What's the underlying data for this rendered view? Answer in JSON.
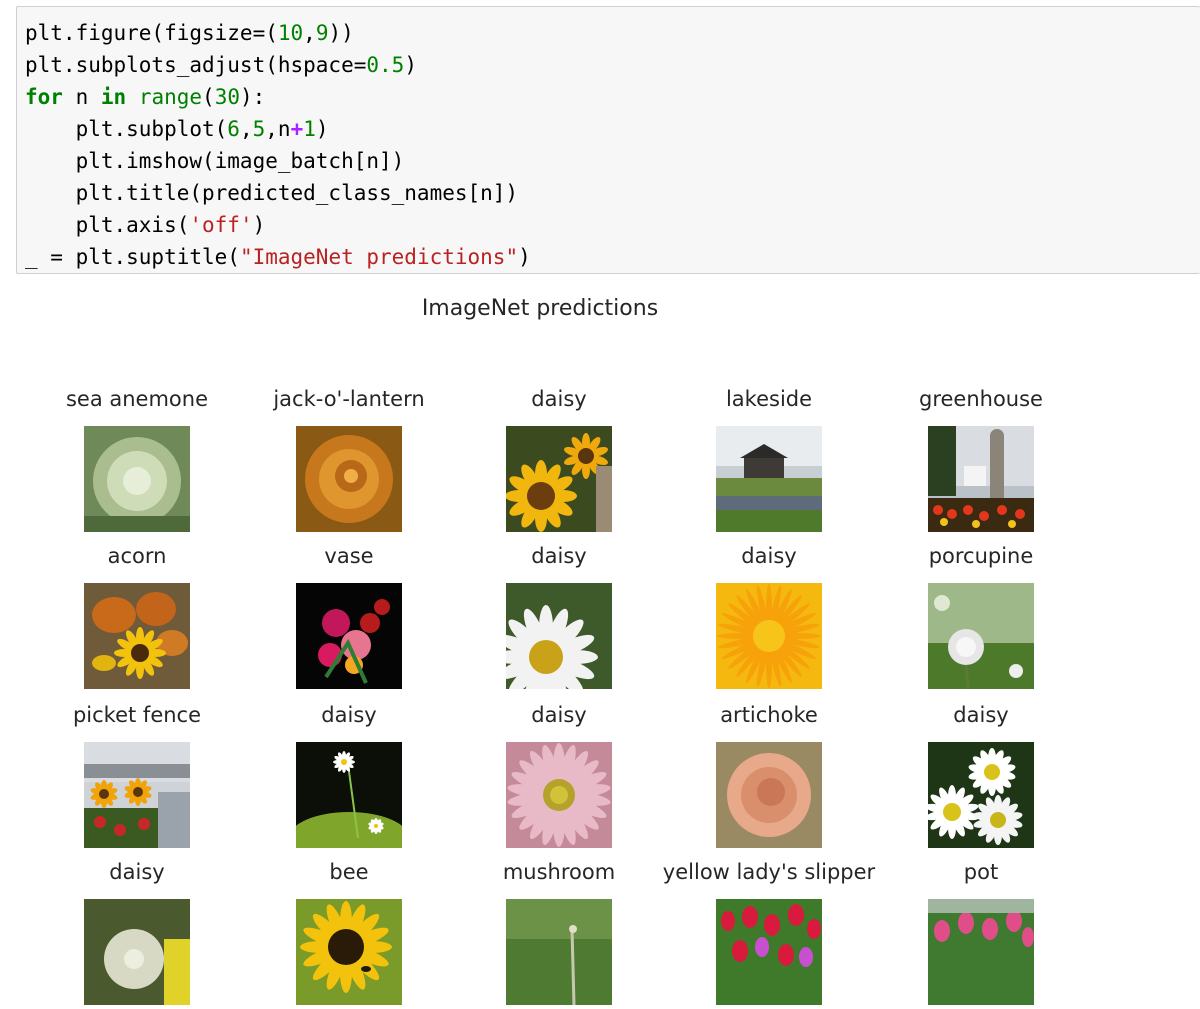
{
  "code": {
    "lines": [
      [
        {
          "t": "plt.figure(figsize=("
        },
        {
          "t": "10",
          "c": "num"
        },
        {
          "t": ","
        },
        {
          "t": "9",
          "c": "num"
        },
        {
          "t": "))"
        }
      ],
      [
        {
          "t": "plt.subplots_adjust(hspace="
        },
        {
          "t": "0.5",
          "c": "num"
        },
        {
          "t": ")"
        }
      ],
      [
        {
          "t": "for",
          "c": "kw"
        },
        {
          "t": " n "
        },
        {
          "t": "in",
          "c": "kw"
        },
        {
          "t": " "
        },
        {
          "t": "range",
          "c": "builtin"
        },
        {
          "t": "("
        },
        {
          "t": "30",
          "c": "num"
        },
        {
          "t": "):"
        }
      ],
      [
        {
          "t": "    plt.subplot("
        },
        {
          "t": "6",
          "c": "num"
        },
        {
          "t": ","
        },
        {
          "t": "5",
          "c": "num"
        },
        {
          "t": ",n"
        },
        {
          "t": "+",
          "c": "op"
        },
        {
          "t": "1",
          "c": "num"
        },
        {
          "t": ")"
        }
      ],
      [
        {
          "t": "    plt.imshow(image_batch[n])"
        }
      ],
      [
        {
          "t": "    plt.title(predicted_class_names[n])"
        }
      ],
      [
        {
          "t": "    plt.axis("
        },
        {
          "t": "'off'",
          "c": "str"
        },
        {
          "t": ")"
        }
      ],
      [
        {
          "t": "_ = plt.suptitle("
        },
        {
          "t": "\"ImageNet predictions\"",
          "c": "str"
        },
        {
          "t": ")"
        }
      ]
    ]
  },
  "figure": {
    "suptitle": "ImageNet predictions",
    "titles": [
      "sea anemone",
      "jack-o'-lantern",
      "daisy",
      "lakeside",
      "greenhouse",
      "acorn",
      "vase",
      "daisy",
      "daisy",
      "porcupine",
      "picket fence",
      "daisy",
      "daisy",
      "artichoke",
      "daisy",
      "daisy",
      "bee",
      "mushroom",
      "yellow lady's slipper",
      "pot"
    ],
    "thumbnails": [
      "dandelion-seedhead-photo",
      "orange-rose-photo",
      "sunflowers-photo",
      "house-by-canal-photo",
      "garden-statue-tulips-photo",
      "pumpkins-sunflower-photo",
      "flower-bouquet-photo",
      "white-daisy-photo",
      "yellow-dandelion-closeup-photo",
      "dandelion-clocks-photo",
      "sunflowers-fence-photo",
      "single-daisy-night-photo",
      "pink-daisy-photo",
      "peach-rose-photo",
      "white-daisies-photo",
      "dandelion-seedhead-yellow-photo",
      "sunflower-bee-photo",
      "grass-photo",
      "red-tulips-photo",
      "pink-tulips-photo"
    ]
  }
}
